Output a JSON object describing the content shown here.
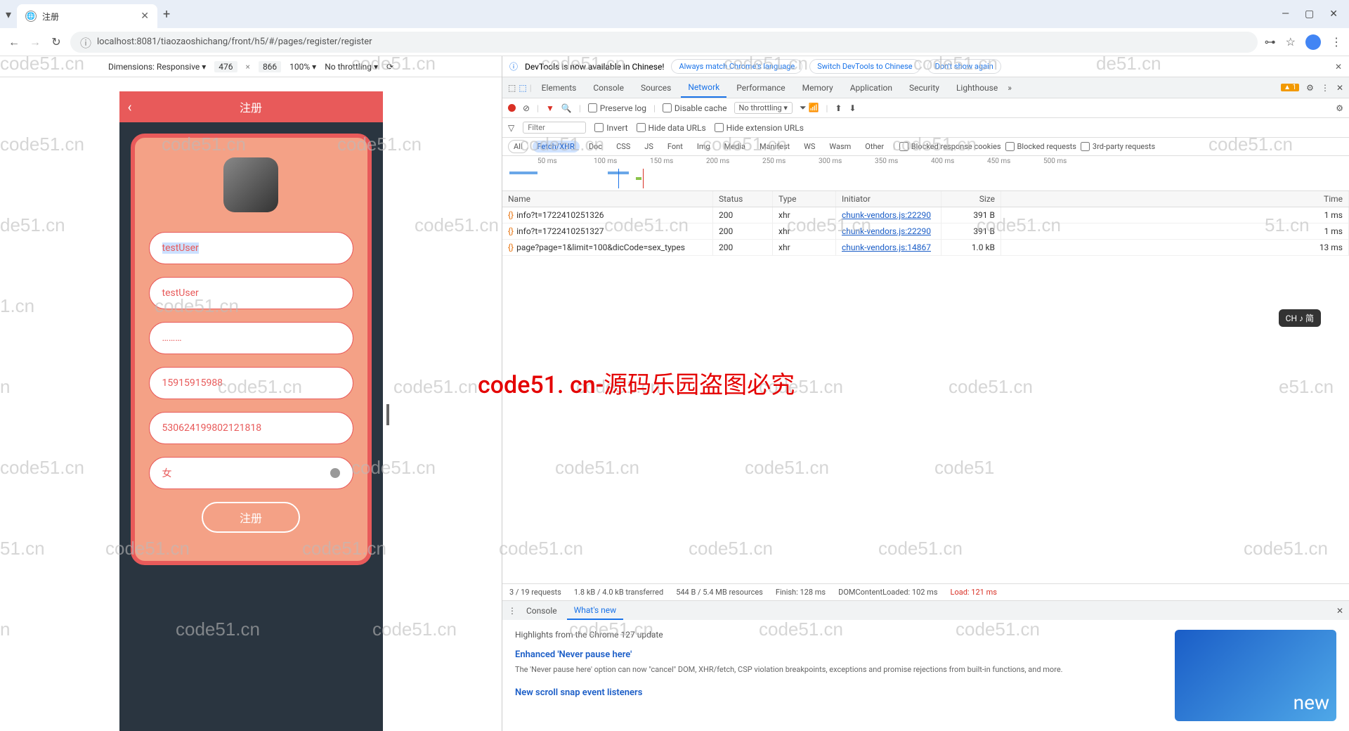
{
  "browser": {
    "tab_title": "注册",
    "url": "localhost:8081/tiaozaoshichang/front/h5/#/pages/register/register"
  },
  "device_bar": {
    "dimensions_label": "Dimensions: Responsive",
    "width": "476",
    "height": "866",
    "zoom": "100%",
    "throttle": "No throttling"
  },
  "app": {
    "header_title": "注册",
    "fields": {
      "username_highlight": "testUser",
      "nickname": "testUser",
      "password": "………",
      "phone": "15915915988",
      "idcard": "530624199802121818",
      "gender": "女"
    },
    "submit": "注册"
  },
  "devtools": {
    "banner": {
      "msg": "DevTools is now available in Chinese!",
      "btn1": "Always match Chrome's language",
      "btn2": "Switch DevTools to Chinese",
      "btn3": "Don't show again"
    },
    "tabs": [
      "Elements",
      "Console",
      "Sources",
      "Network",
      "Performance",
      "Memory",
      "Application",
      "Security",
      "Lighthouse"
    ],
    "active_tab": "Network",
    "warn_count": "1",
    "toolbar": {
      "preserve": "Preserve log",
      "disable_cache": "Disable cache",
      "throttle": "No throttling"
    },
    "filter": {
      "placeholder": "Filter",
      "invert": "Invert",
      "hide_data": "Hide data URLs",
      "hide_ext": "Hide extension URLs"
    },
    "types": [
      "All",
      "Fetch/XHR",
      "Doc",
      "CSS",
      "JS",
      "Font",
      "Img",
      "Media",
      "Manifest",
      "WS",
      "Wasm",
      "Other"
    ],
    "type_checks": [
      "Blocked response cookies",
      "Blocked requests",
      "3rd-party requests"
    ],
    "timeline_ticks": [
      "50 ms",
      "100 ms",
      "150 ms",
      "200 ms",
      "250 ms",
      "300 ms",
      "350 ms",
      "400 ms",
      "450 ms",
      "500 ms"
    ],
    "columns": [
      "Name",
      "Status",
      "Type",
      "Initiator",
      "Size",
      "Time"
    ],
    "rows": [
      {
        "name": "info?t=1722410251326",
        "status": "200",
        "type": "xhr",
        "initiator": "chunk-vendors.js:22290",
        "size": "391 B",
        "time": "1 ms"
      },
      {
        "name": "info?t=1722410251327",
        "status": "200",
        "type": "xhr",
        "initiator": "chunk-vendors.js:22290",
        "size": "391 B",
        "time": "1 ms"
      },
      {
        "name": "page?page=1&limit=100&dicCode=sex_types",
        "status": "200",
        "type": "xhr",
        "initiator": "chunk-vendors.js:14867",
        "size": "1.0 kB",
        "time": "13 ms"
      }
    ],
    "status": {
      "requests": "3 / 19 requests",
      "transferred": "1.8 kB / 4.0 kB transferred",
      "resources": "544 B / 5.4 MB resources",
      "finish": "Finish: 128 ms",
      "dom": "DOMContentLoaded: 102 ms",
      "load": "Load: 121 ms"
    },
    "drawer": {
      "tabs": [
        "Console",
        "What's new"
      ],
      "active": "What's new",
      "highlights": "Highlights from the Chrome 127 update",
      "h1": "Enhanced 'Never pause here'",
      "p1": "The 'Never pause here' option can now \"cancel\" DOM, XHR/fetch, CSP violation breakpoints, exceptions and promise rejections from built-in functions, and more.",
      "h2": "New scroll snap event listeners",
      "img_text": "new"
    }
  },
  "overlay": "code51. cn-源码乐园盗图必究",
  "ime": "CH ♪ 简"
}
